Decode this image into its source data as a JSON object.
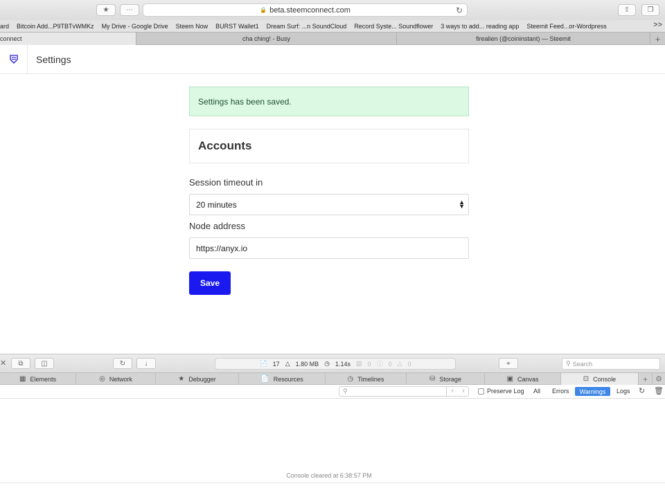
{
  "browser": {
    "url": "beta.steemconnect.com",
    "bookmarks": [
      "ard",
      "Bitcoin Add...P9TBTvWMKz",
      "My Drive - Google Drive",
      "Steem Now",
      "BURST Wallet1",
      "Dream Surf: ...n SoundCloud",
      "Record Syste... Soundflower",
      "3 ways to add... reading app",
      "Steemit Feed...or-Wordpress"
    ],
    "bookmarks_more": ">>",
    "tabs": [
      {
        "label": "connect"
      },
      {
        "label": "cha ching! - Busy"
      },
      {
        "label": "firealien (@coininstant) — Steemit"
      }
    ],
    "new_tab": "+"
  },
  "page": {
    "title": "Settings",
    "alert": "Settings has been saved.",
    "section_title": "Accounts",
    "timeout_label": "Session timeout in",
    "timeout_value": "20 minutes",
    "node_label": "Node address",
    "node_value": "https://anyx.io",
    "save_label": "Save"
  },
  "devtools": {
    "resources_count": "17",
    "memory": "1.80 MB",
    "load_time": "1.14s",
    "log_count": "0",
    "error_count": "0",
    "warning_count": "0",
    "search_placeholder": "Search",
    "tabs": [
      "Elements",
      "Network",
      "Debugger",
      "Resources",
      "Timelines",
      "Storage",
      "Canvas",
      "Console"
    ],
    "preserve_log": "Preserve Log",
    "filter_all": "All",
    "filter_errors": "Errors",
    "filter_warnings": "Warnings",
    "filter_logs": "Logs",
    "cleared_message": "Console cleared at 6:38:57 PM"
  },
  "colors": {
    "primary": "#1919f0",
    "alert_bg": "#dcf9e3",
    "active_filter": "#3e87e6"
  }
}
